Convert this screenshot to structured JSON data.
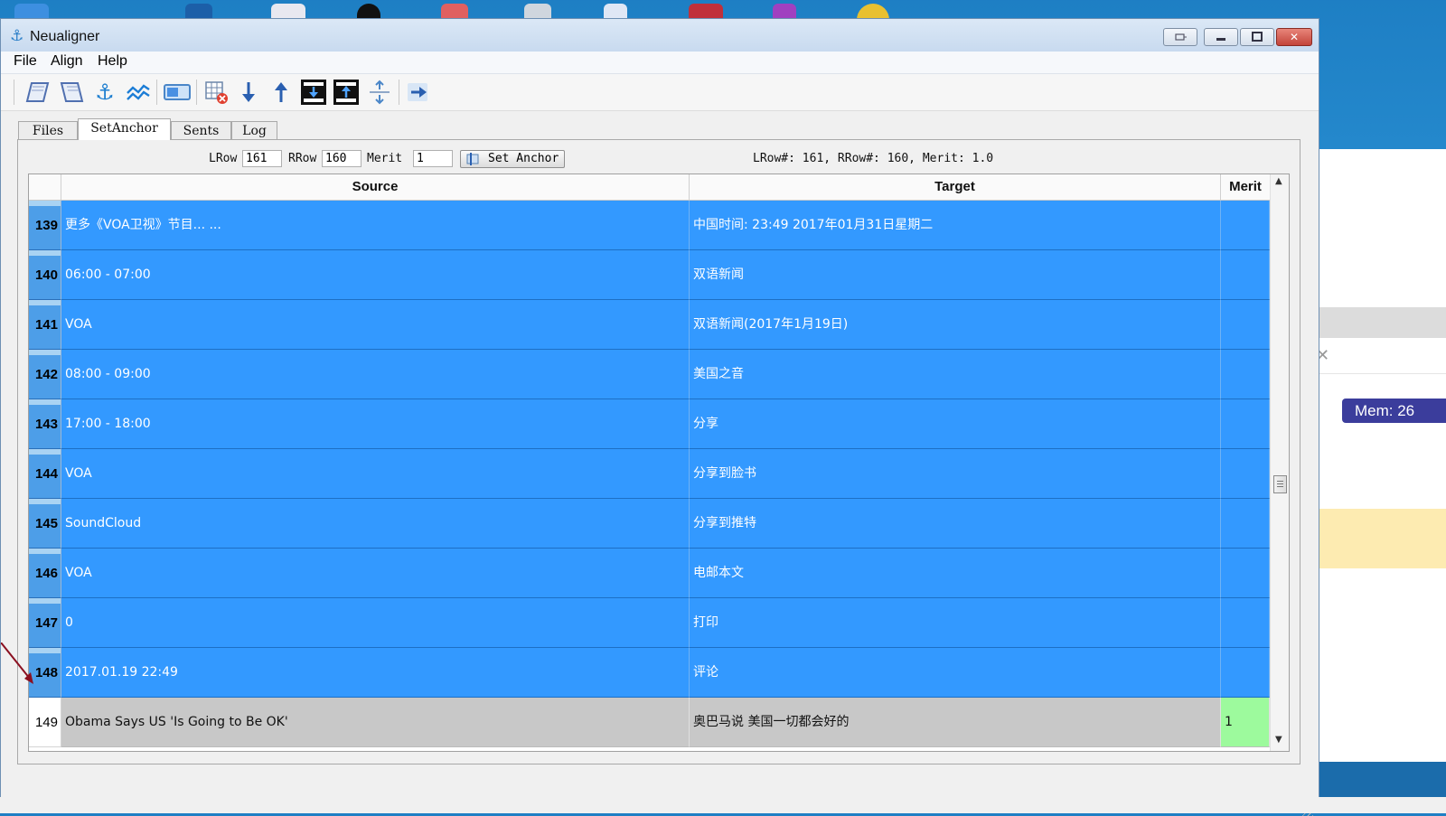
{
  "window": {
    "title": "Neualigner"
  },
  "menu": [
    "File",
    "Align",
    "Help"
  ],
  "tabs": [
    "Files",
    "SetAnchor",
    "Sents",
    "Log"
  ],
  "controls": {
    "lrow_label": "LRow",
    "lrow_value": "161",
    "rrow_label": "RRow",
    "rrow_value": "160",
    "merit_label": "Merit",
    "merit_value": "1",
    "set_anchor_label": "Set Anchor",
    "status": "LRow#: 161, RRow#: 160, Merit: 1.0"
  },
  "table": {
    "headers": {
      "source": "Source",
      "target": "Target",
      "merit": "Merit"
    },
    "rows": [
      {
        "num": "139",
        "source": "更多《VOA卫视》节目... ...",
        "target": "中国时间: 23:49 2017年01月31日星期二",
        "merit": ""
      },
      {
        "num": "140",
        "source": "06:00 - 07:00",
        "target": "双语新闻",
        "merit": ""
      },
      {
        "num": "141",
        "source": "VOA",
        "target": "双语新闻(2017年1月19日)",
        "merit": ""
      },
      {
        "num": "142",
        "source": "08:00 - 09:00",
        "target": "美国之音",
        "merit": ""
      },
      {
        "num": "143",
        "source": "17:00 - 18:00",
        "target": "分享",
        "merit": ""
      },
      {
        "num": "144",
        "source": "VOA",
        "target": "分享到脸书",
        "merit": ""
      },
      {
        "num": "145",
        "source": "SoundCloud",
        "target": "分享到推特",
        "merit": ""
      },
      {
        "num": "146",
        "source": "VOA",
        "target": "电邮本文",
        "merit": ""
      },
      {
        "num": "147",
        "source": "0",
        "target": "打印",
        "merit": ""
      },
      {
        "num": "148",
        "source": "2017.01.19 22:49",
        "target": "评论",
        "merit": ""
      },
      {
        "num": "149",
        "source": "Obama Says US 'Is Going to Be OK'",
        "target": "奥巴马说  美国一切都会好的",
        "merit": "1"
      }
    ]
  },
  "background_app": {
    "mem_label": "Mem: 26"
  },
  "colors": {
    "selected_row": "#3399ff",
    "unselected_row": "#c8c8c8",
    "merit_highlight": "#9dfa9d"
  }
}
